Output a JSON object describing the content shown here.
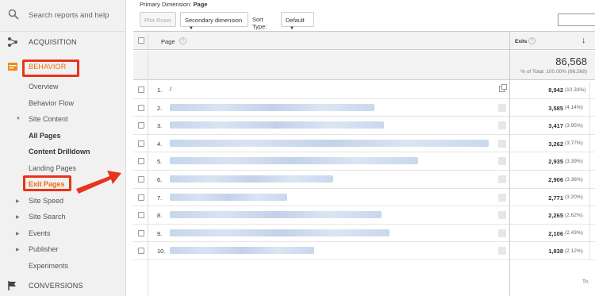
{
  "sidebar": {
    "search_placeholder": "Search reports and help",
    "acquisition": "ACQUISITION",
    "behavior": "BEHAVIOR",
    "overview": "Overview",
    "behavior_flow": "Behavior Flow",
    "site_content": "Site Content",
    "all_pages": "All Pages",
    "content_drilldown": "Content Drilldown",
    "landing_pages": "Landing Pages",
    "exit_pages": "Exit Pages",
    "site_speed": "Site Speed",
    "site_search": "Site Search",
    "events": "Events",
    "publisher": "Publisher",
    "experiments": "Experiments",
    "conversions": "CONVERSIONS"
  },
  "header": {
    "primary_dimension_label": "Primary Dimension:",
    "primary_dimension_value": "Page"
  },
  "toolbar": {
    "plot_rows": "Plot Rows",
    "secondary_dimension": "Secondary dimension",
    "sort_type_label": "Sort Type:",
    "sort_type_value": "Default"
  },
  "table": {
    "col_page": "Page",
    "col_exits": "Exits",
    "total_value": "86,568",
    "total_sub": "% of Total: 100.00% (86,568)",
    "footer": "Th",
    "rows": [
      {
        "num": "1.",
        "page": "/",
        "value": "8,942",
        "pct": "(10.33%)"
      },
      {
        "num": "2.",
        "page": "",
        "value": "3,585",
        "pct": "(4.14%)"
      },
      {
        "num": "3.",
        "page": "",
        "value": "3,417",
        "pct": "(3.95%)"
      },
      {
        "num": "4.",
        "page": "",
        "value": "3,262",
        "pct": "(3.77%)"
      },
      {
        "num": "5.",
        "page": "",
        "value": "2,935",
        "pct": "(3.39%)"
      },
      {
        "num": "6.",
        "page": "",
        "value": "2,906",
        "pct": "(3.36%)"
      },
      {
        "num": "7.",
        "page": "",
        "value": "2,771",
        "pct": "(3.20%)"
      },
      {
        "num": "8.",
        "page": "",
        "value": "2,265",
        "pct": "(2.62%)"
      },
      {
        "num": "9.",
        "page": "",
        "value": "2,106",
        "pct": "(2.43%)"
      },
      {
        "num": "10.",
        "page": "",
        "value": "1,838",
        "pct": "(2.12%)"
      }
    ]
  },
  "colors": {
    "highlight": "#e8341c",
    "behavior_orange": "#ef6c00",
    "link_blue": "#1a53b0"
  }
}
